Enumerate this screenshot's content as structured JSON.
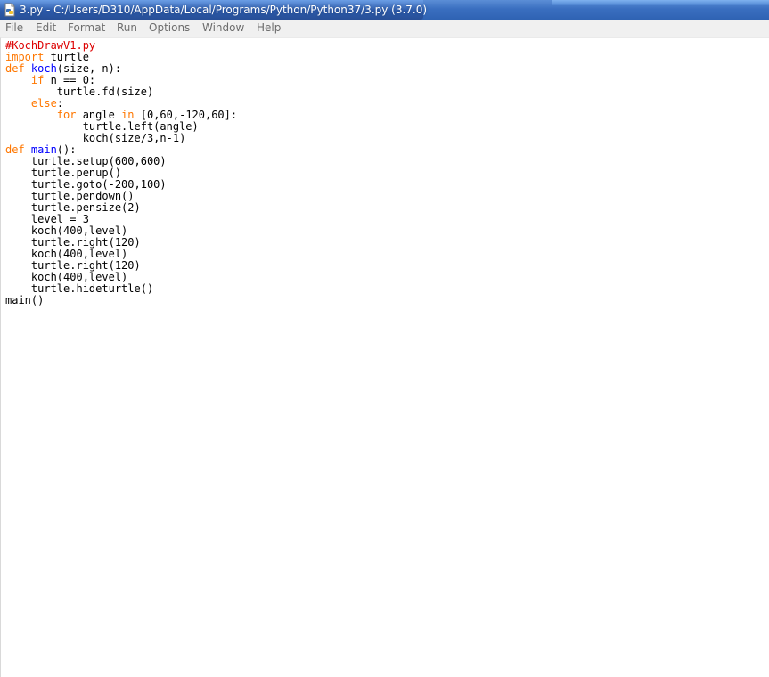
{
  "window": {
    "title": "3.py - C:/Users/D310/AppData/Local/Programs/Python/Python37/3.py (3.7.0)",
    "icon": "python-file-icon"
  },
  "menubar": {
    "items": [
      "File",
      "Edit",
      "Format",
      "Run",
      "Options",
      "Window",
      "Help"
    ]
  },
  "colors": {
    "comment": "#dd0000",
    "keyword": "#ff7700",
    "definition": "#0000ff",
    "text": "#000000",
    "menu_text": "#6d6d6d",
    "titlebar": "#2f63b3"
  },
  "editor": {
    "lines": [
      [
        {
          "t": "#KochDrawV1.py",
          "k": "comment"
        }
      ],
      [
        {
          "t": "import",
          "k": "keyword"
        },
        {
          "t": " turtle",
          "k": "plain"
        }
      ],
      [
        {
          "t": "def",
          "k": "keyword"
        },
        {
          "t": " ",
          "k": "plain"
        },
        {
          "t": "koch",
          "k": "def"
        },
        {
          "t": "(size, n):",
          "k": "plain"
        }
      ],
      [
        {
          "t": "    ",
          "k": "plain"
        },
        {
          "t": "if",
          "k": "keyword"
        },
        {
          "t": " n == 0:",
          "k": "plain"
        }
      ],
      [
        {
          "t": "        turtle.fd(size)",
          "k": "plain"
        }
      ],
      [
        {
          "t": "    ",
          "k": "plain"
        },
        {
          "t": "else",
          "k": "keyword"
        },
        {
          "t": ":",
          "k": "plain"
        }
      ],
      [
        {
          "t": "        ",
          "k": "plain"
        },
        {
          "t": "for",
          "k": "keyword"
        },
        {
          "t": " angle ",
          "k": "plain"
        },
        {
          "t": "in",
          "k": "keyword"
        },
        {
          "t": " [0,60,-120,60]:",
          "k": "plain"
        }
      ],
      [
        {
          "t": "            turtle.left(angle)",
          "k": "plain"
        }
      ],
      [
        {
          "t": "            koch(size/3,n-1)",
          "k": "plain"
        }
      ],
      [
        {
          "t": "def",
          "k": "keyword"
        },
        {
          "t": " ",
          "k": "plain"
        },
        {
          "t": "main",
          "k": "def"
        },
        {
          "t": "():",
          "k": "plain"
        }
      ],
      [
        {
          "t": "    turtle.setup(600,600)",
          "k": "plain"
        }
      ],
      [
        {
          "t": "    turtle.penup()",
          "k": "plain"
        }
      ],
      [
        {
          "t": "    turtle.goto(-200,100)",
          "k": "plain"
        }
      ],
      [
        {
          "t": "    turtle.pendown()",
          "k": "plain"
        }
      ],
      [
        {
          "t": "    turtle.pensize(2)",
          "k": "plain"
        }
      ],
      [
        {
          "t": "    level = 3",
          "k": "plain"
        }
      ],
      [
        {
          "t": "    koch(400,level)",
          "k": "plain"
        }
      ],
      [
        {
          "t": "    turtle.right(120)",
          "k": "plain"
        }
      ],
      [
        {
          "t": "    koch(400,level)",
          "k": "plain"
        }
      ],
      [
        {
          "t": "    turtle.right(120)",
          "k": "plain"
        }
      ],
      [
        {
          "t": "    koch(400,level)",
          "k": "plain"
        }
      ],
      [
        {
          "t": "    turtle.hideturtle()",
          "k": "plain"
        }
      ],
      [
        {
          "t": "main()",
          "k": "plain"
        }
      ]
    ]
  }
}
